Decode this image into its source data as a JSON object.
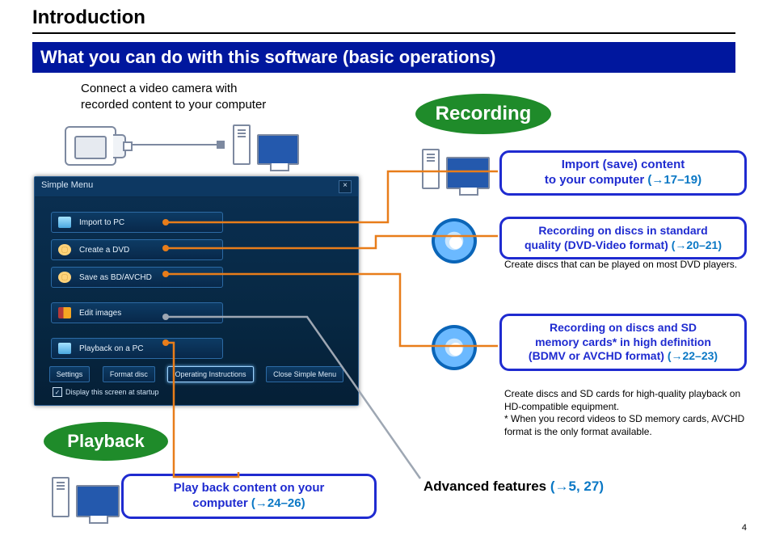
{
  "page": {
    "heading": "Introduction",
    "subheading": "What you can do with this software (basic operations)",
    "connect_text_l1": "Connect a video camera with",
    "connect_text_l2": "recorded content to your computer",
    "page_number": "4"
  },
  "sections": {
    "recording_label": "Recording",
    "playback_label": "Playback",
    "advanced_label": "Advanced features ",
    "advanced_pages": "(→5, 27)"
  },
  "boxes": {
    "import": {
      "l1": "Import (save) content",
      "l2": "to your computer ",
      "pages": "(→17–19)"
    },
    "dvd": {
      "l1": "Recording on discs in standard",
      "l2": "quality (DVD-Video format) ",
      "pages": "(→20–21)",
      "caption": "Create discs that can be played on most DVD players."
    },
    "hd": {
      "l1": "Recording on discs and SD",
      "l2": "memory cards* in high definition",
      "l3": "(BDMV or AVCHD format) ",
      "pages": "(→22–23)",
      "caption1": "Create discs and SD cards for high-quality playback on HD-compatible equipment.",
      "caption2": "* When you record videos to SD memory cards, AVCHD format is the only format available."
    },
    "play": {
      "l1": "Play back content on your",
      "l2": "computer ",
      "pages": "(→24–26)"
    }
  },
  "simple_menu": {
    "title": "Simple Menu",
    "close": "×",
    "items": {
      "import": "Import to PC",
      "create": "Create a DVD",
      "save_bd": "Save as BD/AVCHD",
      "edit": "Edit images",
      "playback": "Playback on a PC"
    },
    "bottom": {
      "settings": "Settings",
      "format": "Format disc",
      "ops": "Operating Instructions",
      "close": "Close Simple Menu"
    },
    "startup_check": "Display this screen at startup"
  }
}
